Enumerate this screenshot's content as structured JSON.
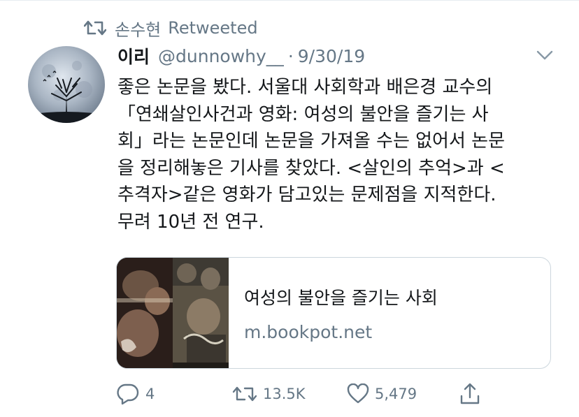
{
  "retweet_context": {
    "retweeter": "손수현",
    "label": "Retweeted"
  },
  "tweet": {
    "display_name": "이리",
    "handle": "@dunnowhy__",
    "separator": "·",
    "date": "9/30/19",
    "text_lines": [
      "좋은 논문을 봤다. 서울대 사회학과 배은경 교수의",
      "「연쇄살인사건과 영화: 여성의 불안을 즐기는 사",
      "회」라는 논문인데 논문을 가져올 수는 없어서 논문",
      "을 정리해놓은 기사를 찾았다. <살인의 추억>과 <",
      "추격자>같은 영화가 담고있는 문제점을 지적한다.",
      "무려 10년 전 연구."
    ]
  },
  "link_card": {
    "title": "여성의 불안을 즐기는 사회",
    "domain": "m.bookpot.net"
  },
  "actions": {
    "replies": "4",
    "retweets": "13.5K",
    "likes": "5,479"
  },
  "icons": {
    "retweet_context": "retweet-icon",
    "menu": "chevron-down-icon",
    "reply": "reply-icon",
    "retweet": "retweet-icon",
    "like": "heart-icon",
    "share": "share-icon"
  },
  "colors": {
    "text": "#14171a",
    "secondary": "#657786",
    "border": "#ccd6dd"
  }
}
